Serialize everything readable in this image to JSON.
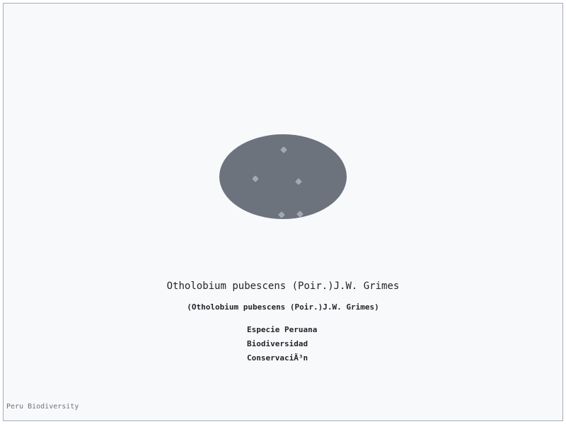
{
  "specimen": {
    "body_color": "#6d737d",
    "spot_color": "#a3a9b1"
  },
  "species": {
    "name": "Otholobium pubescens (Poir.)J.W. Grimes",
    "name_parenthetical": "(Otholobium pubescens (Poir.)J.W. Grimes)"
  },
  "tags": [
    "Especie Peruana",
    "Biodiversidad",
    "ConservaciÃ³n"
  ],
  "footer": {
    "brand": "Peru Biodiversity"
  },
  "colors": {
    "background": "#f8f9fb",
    "border": "#a6acb4",
    "text": "#1f2328",
    "muted_text": "#6c737c"
  }
}
